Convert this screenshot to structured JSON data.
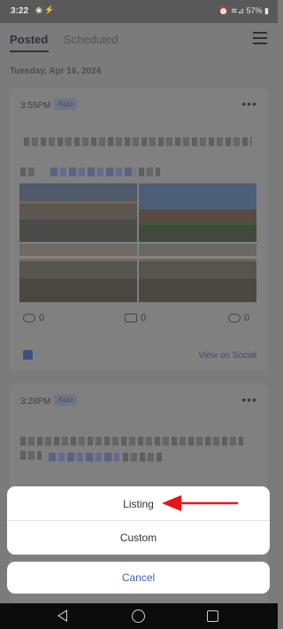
{
  "status_bar": {
    "time": "3:22",
    "left_icons": "◉ ⚡",
    "right_icons": "⏰ ≋⊿ 57% ▮"
  },
  "tabs": {
    "posted": "Posted",
    "scheduled": "Scheduled"
  },
  "date_header": "Tuesday, Apr 16, 2024",
  "posts": [
    {
      "time": "3:55PM",
      "badge": "Auto",
      "views": "0",
      "shares": "0",
      "users": "0",
      "view_on_social": "View on Social"
    },
    {
      "time": "3:28PM",
      "badge": "Auto"
    }
  ],
  "action_sheet": {
    "listing": "Listing",
    "custom": "Custom",
    "cancel": "Cancel"
  },
  "colors": {
    "accent": "#3d5fb3",
    "arrow": "#e8141c"
  }
}
